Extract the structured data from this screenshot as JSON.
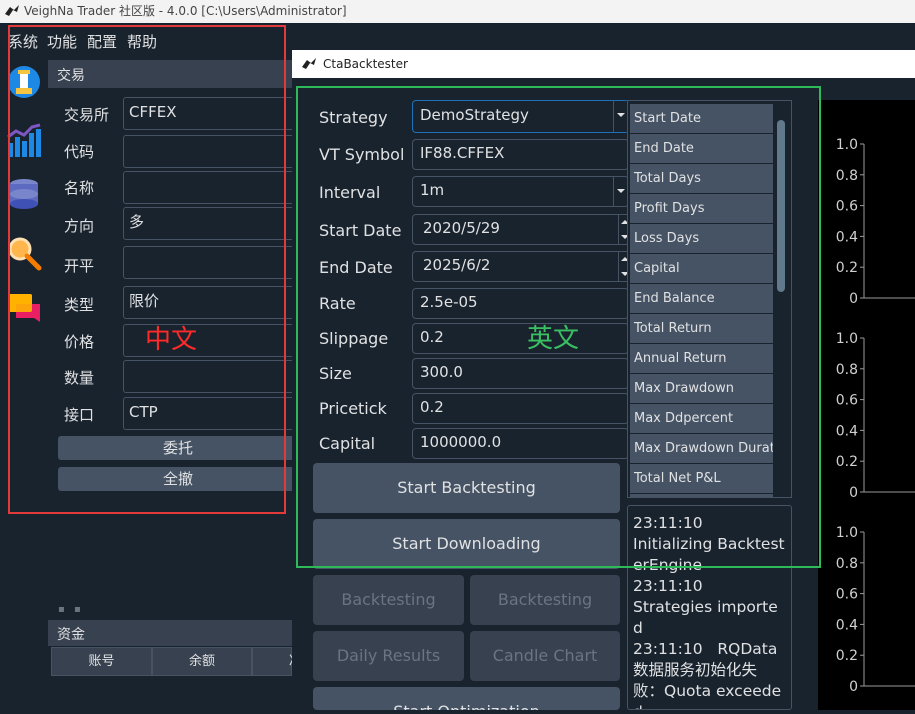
{
  "window": {
    "title": "VeighNa Trader 社区版 - 4.0.0   [C:\\Users\\Administrator]",
    "menu": [
      "系统",
      "功能",
      "配置",
      "帮助"
    ]
  },
  "left_icons": [
    "trading-icon",
    "chart-icon",
    "database-icon",
    "search-icon",
    "chat-icon"
  ],
  "trade_panel": {
    "title": "交易",
    "fields": [
      {
        "label": "交易所",
        "value": "CFFEX"
      },
      {
        "label": "代码",
        "value": ""
      },
      {
        "label": "名称",
        "value": ""
      },
      {
        "label": "方向",
        "value": "多"
      },
      {
        "label": "开平",
        "value": ""
      },
      {
        "label": "类型",
        "value": "限价"
      },
      {
        "label": "价格",
        "value": ""
      },
      {
        "label": "数量",
        "value": ""
      },
      {
        "label": "接口",
        "value": "CTP"
      }
    ],
    "send_button": "委托",
    "cancel_all_button": "全撤"
  },
  "fund_panel": {
    "title": "资金",
    "columns": [
      "账号",
      "余额",
      "冻"
    ]
  },
  "backtester": {
    "title": "CtaBacktester",
    "params": [
      {
        "label": "Strategy",
        "value": "DemoStrategy",
        "kind": "combo"
      },
      {
        "label": "VT Symbol",
        "value": "IF88.CFFEX",
        "kind": "text"
      },
      {
        "label": "Interval",
        "value": "1m",
        "kind": "combo"
      },
      {
        "label": "Start Date",
        "value": "2020/5/29",
        "kind": "date"
      },
      {
        "label": "End Date",
        "value": "2025/6/2",
        "kind": "date"
      },
      {
        "label": "Rate",
        "value": "2.5e-05",
        "kind": "text"
      },
      {
        "label": "Slippage",
        "value": "0.2",
        "kind": "text"
      },
      {
        "label": "Size",
        "value": "300.0",
        "kind": "text"
      },
      {
        "label": "Pricetick",
        "value": "0.2",
        "kind": "text"
      },
      {
        "label": "Capital",
        "value": "1000000.0",
        "kind": "text"
      }
    ],
    "buttons": {
      "start_backtesting": "Start Backtesting",
      "start_downloading": "Start Downloading",
      "backtesting_trades": "Backtesting Trades",
      "backtesting_orders": "Backtesting Orders",
      "daily_results": "Daily Results",
      "candle_chart": "Candle Chart",
      "start_optimization": "Start Optimization"
    },
    "result_rows": [
      "Start Date",
      "End Date",
      "Total Days",
      "Profit Days",
      "Loss Days",
      "Capital",
      "End Balance",
      "Total Return",
      "Annual Return",
      "Max Drawdown",
      "Max Ddpercent",
      "Max Drawdown Durati",
      "Total Net P&L"
    ],
    "log": [
      "23:11:10",
      "Initializing BacktesterEngine",
      "23:11:10",
      "Strategies imported",
      "23:11:10   RQData数据服务初始化失败：Quota exceeded"
    ]
  },
  "chart_data": [
    {
      "type": "line",
      "yticks": [
        "1.0",
        "0.8",
        "0.6",
        "0.4",
        "0.2",
        "0"
      ],
      "ylim": [
        0,
        1
      ],
      "series": []
    },
    {
      "type": "line",
      "yticks": [
        "1.0",
        "0.8",
        "0.6",
        "0.4",
        "0.2",
        "0"
      ],
      "ylim": [
        0,
        1
      ],
      "series": []
    },
    {
      "type": "line",
      "yticks": [
        "1.0",
        "0.8",
        "0.6",
        "0.4",
        "0.2",
        "0"
      ],
      "ylim": [
        0,
        1
      ],
      "series": []
    }
  ],
  "annotations": {
    "chinese_label": "中文",
    "english_label": "英文",
    "red_box_color": "#e23a3a",
    "green_box_color": "#2fba5a"
  }
}
